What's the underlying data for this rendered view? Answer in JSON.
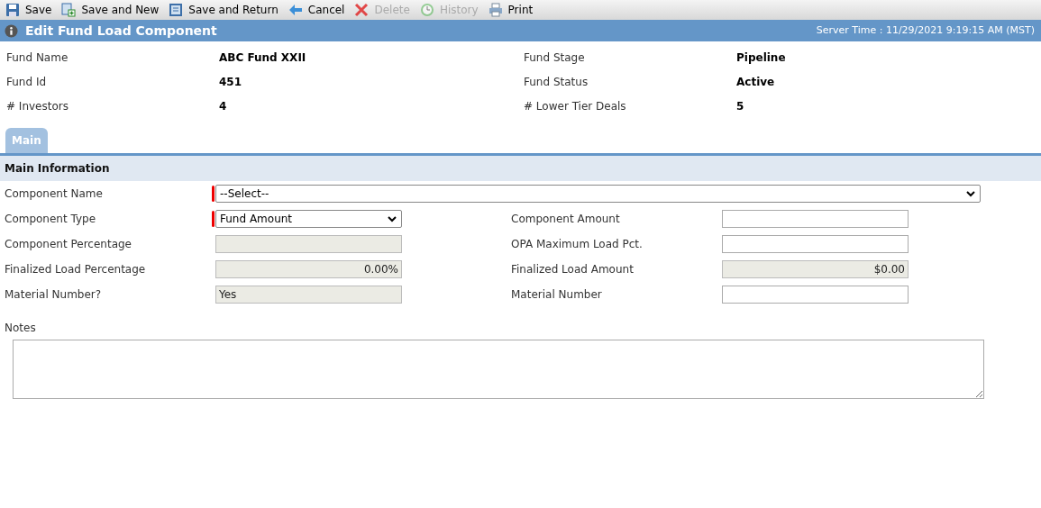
{
  "toolbar": [
    {
      "kind": "save",
      "label": "Save",
      "disabled": false
    },
    {
      "kind": "save_new",
      "label": "Save and New",
      "disabled": false
    },
    {
      "kind": "save_return",
      "label": "Save and Return",
      "disabled": false
    },
    {
      "kind": "cancel",
      "label": "Cancel",
      "disabled": false
    },
    {
      "kind": "delete",
      "label": "Delete",
      "disabled": true
    },
    {
      "kind": "history",
      "label": "History",
      "disabled": true
    },
    {
      "kind": "print",
      "label": "Print",
      "disabled": false
    }
  ],
  "header": {
    "title": "Edit Fund Load Component",
    "server_time": "Server Time : 11/29/2021 9:19:15 AM (MST)"
  },
  "summary": [
    {
      "label": "Fund Name",
      "value": "ABC Fund XXII"
    },
    {
      "label": "Fund Stage",
      "value": "Pipeline"
    },
    {
      "label": "Fund Id",
      "value": "451"
    },
    {
      "label": "Fund Status",
      "value": "Active"
    },
    {
      "label": "# Investors",
      "value": "4"
    },
    {
      "label": "# Lower Tier Deals",
      "value": "5"
    }
  ],
  "tabs": [
    {
      "label": "Main",
      "selected": true
    }
  ],
  "section": {
    "title": "Main Information"
  },
  "fields": [
    {
      "label": "Component Name",
      "kind": "select",
      "value": "--Select--",
      "required": true,
      "wide": true
    },
    {
      "label": "Component Type",
      "kind": "select",
      "value": "Fund Amount",
      "required": true
    },
    {
      "label": "Component Amount",
      "kind": "text"
    },
    {
      "label": "Component Percentage",
      "kind": "readonly"
    },
    {
      "label": "OPA Maximum Load Pct.",
      "kind": "text"
    },
    {
      "label": "Finalized Load Percentage",
      "kind": "readonly",
      "value": "0.00%",
      "right_aligned": true
    },
    {
      "label": "Finalized Load Amount",
      "kind": "readonly",
      "value": "$0.00",
      "right_aligned": true
    },
    {
      "label": "Material Number?",
      "kind": "readonly",
      "value": "Yes"
    },
    {
      "label": "Material Number",
      "kind": "text"
    }
  ],
  "notes": {
    "label": "Notes"
  }
}
